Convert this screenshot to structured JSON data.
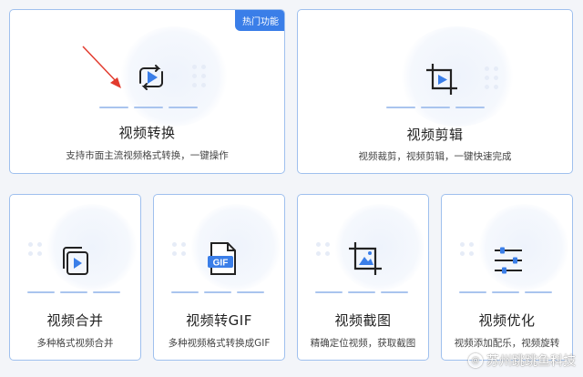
{
  "accent_color": "#3a7ee8",
  "cards": [
    {
      "id": "video-convert",
      "title": "视频转换",
      "desc": "支持市面主流视频格式转换，一键操作",
      "badge": "热门功能",
      "icon": "convert-icon"
    },
    {
      "id": "video-edit",
      "title": "视频剪辑",
      "desc": "视频裁剪，视频剪辑，一键快速完成",
      "icon": "crop-icon"
    },
    {
      "id": "video-merge",
      "title": "视频合并",
      "desc": "多种格式视频合并",
      "icon": "merge-icon"
    },
    {
      "id": "video-to-gif",
      "title": "视频转GIF",
      "desc": "多种视频格式转换成GIF",
      "icon": "gif-file-icon",
      "icon_label": "GIF"
    },
    {
      "id": "video-screenshot",
      "title": "视频截图",
      "desc": "精确定位视频，获取截图",
      "icon": "screenshot-icon"
    },
    {
      "id": "video-optimize",
      "title": "视频优化",
      "desc": "视频添加配乐，视频旋转",
      "icon": "sliders-icon"
    }
  ],
  "watermark": {
    "text": "苏州跳跳鱼科技",
    "symbol": "@"
  }
}
